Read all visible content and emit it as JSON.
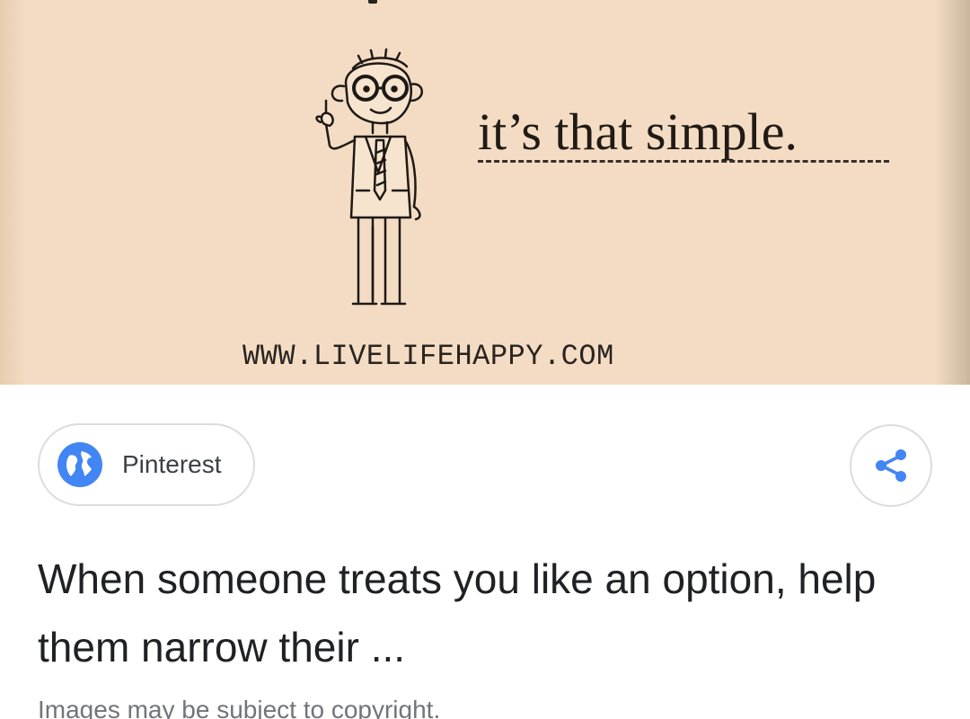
{
  "image": {
    "caption": "it’s that simple.",
    "website": "WWW.LIVELIFEHAPPY.COM",
    "illustration_icon": "cartoon-man-pointing-up"
  },
  "source": {
    "label": "Pinterest",
    "icon": "globe-icon",
    "icon_color": "#4285f4"
  },
  "share": {
    "icon": "share-icon",
    "icon_color": "#4285f4"
  },
  "result": {
    "title": "When someone treats you like an option, help them narrow their ...",
    "copyright_note": "Images may be subject to copyright."
  }
}
